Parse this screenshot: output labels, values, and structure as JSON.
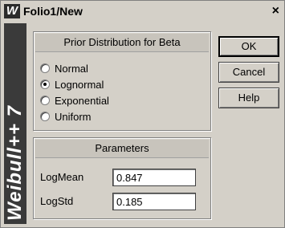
{
  "window": {
    "title": "Folio1/New",
    "icon_letter": "W",
    "close_symbol": "×"
  },
  "brand": {
    "text": "Weibull++ 7"
  },
  "prior_group": {
    "title": "Prior Distribution for Beta",
    "options": [
      {
        "label": "Normal",
        "checked": false
      },
      {
        "label": "Lognormal",
        "checked": true
      },
      {
        "label": "Exponential",
        "checked": false
      },
      {
        "label": "Uniform",
        "checked": false
      }
    ]
  },
  "parameters_group": {
    "title": "Parameters",
    "fields": [
      {
        "label": "LogMean",
        "value": "0.847"
      },
      {
        "label": "LogStd",
        "value": "0.185"
      }
    ]
  },
  "buttons": {
    "ok": "OK",
    "cancel": "Cancel",
    "help": "Help"
  }
}
